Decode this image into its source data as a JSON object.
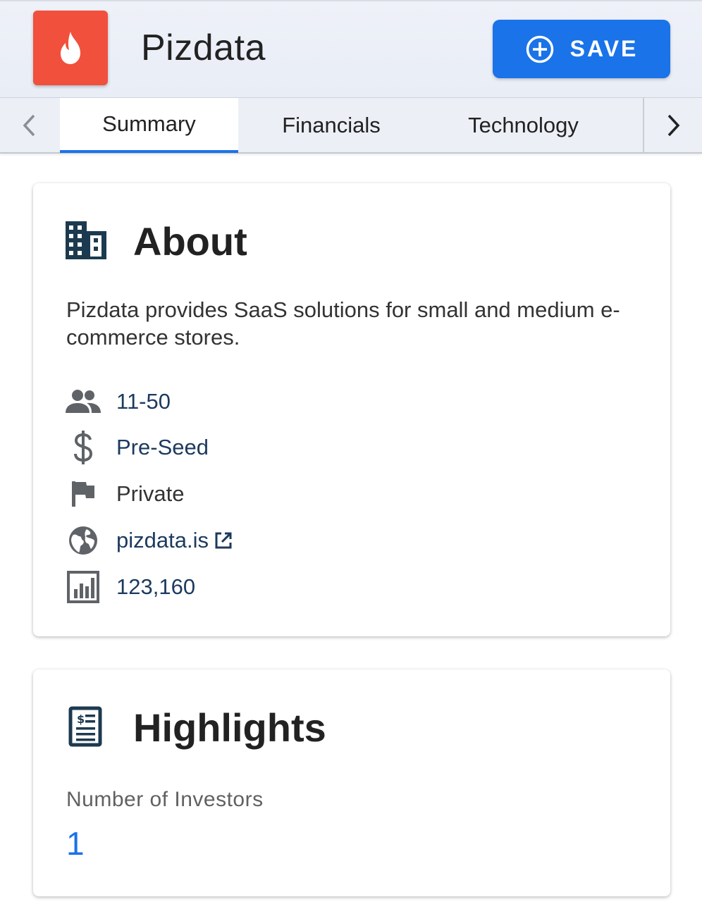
{
  "header": {
    "company_name": "Pizdata",
    "save_label": "SAVE"
  },
  "tabs": [
    {
      "label": "Summary",
      "active": true
    },
    {
      "label": "Financials",
      "active": false
    },
    {
      "label": "Technology",
      "active": false
    }
  ],
  "about": {
    "title": "About",
    "description": "Pizdata provides SaaS solutions for small and medium e-commerce stores.",
    "rows": [
      {
        "icon": "people-icon",
        "value": "11-50"
      },
      {
        "icon": "dollar-icon",
        "value": "Pre-Seed"
      },
      {
        "icon": "flag-icon",
        "value": "Private"
      },
      {
        "icon": "globe-icon",
        "value": "pizdata.is"
      },
      {
        "icon": "bar-chart-icon",
        "value": "123,160"
      }
    ]
  },
  "highlights": {
    "title": "Highlights",
    "investors_label": "Number of Investors",
    "investors_value": "1"
  },
  "colors": {
    "brand_logo": "#f1503c",
    "accent_blue": "#1a73e8",
    "link_navy": "#1c3a5e"
  }
}
